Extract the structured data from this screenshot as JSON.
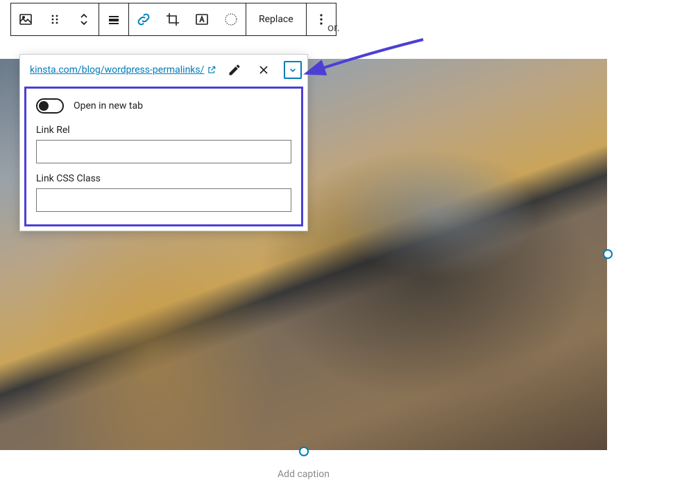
{
  "toolbar": {
    "replace_label": "Replace"
  },
  "partial_text": "or.",
  "link": {
    "url": "kinsta.com/blog/wordpress-permalinks/",
    "settings": {
      "open_new_tab_label": "Open in new tab",
      "link_rel_label": "Link Rel",
      "link_rel_value": "",
      "link_css_class_label": "Link CSS Class",
      "link_css_class_value": ""
    }
  },
  "caption_placeholder": "Add caption"
}
